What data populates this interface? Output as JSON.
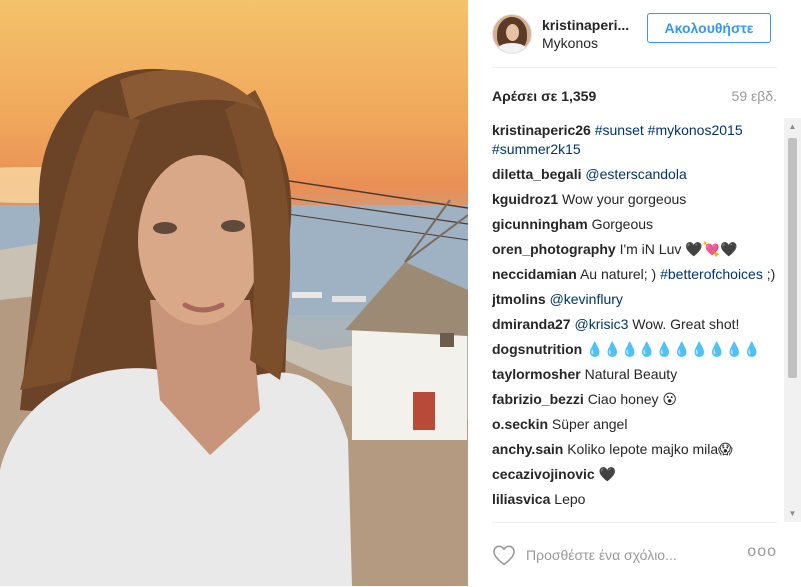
{
  "post": {
    "username": "kristinaperi...",
    "location": "Mykonos",
    "follow_label": "Ακολουθήστε",
    "likes": "Αρέσει σε 1,359",
    "time": "59 εβδ."
  },
  "comments": [
    {
      "user": "kristinaperic26",
      "link": "#sunset #mykonos2015 #summer2k15",
      "text": ""
    },
    {
      "user": "diletta_begali",
      "link": "@esterscandola",
      "text": ""
    },
    {
      "user": "kguidroz1",
      "link": "",
      "text": "Wow your gorgeous"
    },
    {
      "user": "gicunningham",
      "link": "",
      "text": "Gorgeous"
    },
    {
      "user": "oren_photography",
      "link": "",
      "text": "I'm iN Luv 🖤💘🖤"
    },
    {
      "user": "neccidamian",
      "link": "",
      "text": "Au naturel; )",
      "link2": "#betterofchoices",
      "text2": ";)"
    },
    {
      "user": "jtmolins",
      "link": "@kevinflury",
      "text": ""
    },
    {
      "user": "dmiranda27",
      "link": "@krisic3",
      "text": "Wow. Great shot!"
    },
    {
      "user": "dogsnutrition",
      "link": "",
      "text": "💧💧💧💧💧💧💧💧💧💧"
    },
    {
      "user": "taylormosher",
      "link": "",
      "text": "Natural Beauty"
    },
    {
      "user": "fabrizio_bezzi",
      "link": "",
      "text": "Ciao honey 😮"
    },
    {
      "user": "o.seckin",
      "link": "",
      "text": "Süper angel"
    },
    {
      "user": "anchy.sain",
      "link": "",
      "text": "Koliko lepote majko mila😱"
    },
    {
      "user": "cecazivojinovic",
      "link": "",
      "text": "🖤"
    },
    {
      "user": "liliasvica",
      "link": "",
      "text": "Lepo"
    }
  ],
  "footer": {
    "placeholder": "Προσθέστε ένα σχόλιο...",
    "more": "ooo"
  },
  "icons": {
    "like": "heart-outline-icon",
    "options": "more-options-icon"
  },
  "colors": {
    "link": "#003569",
    "follow": "#3897f0"
  }
}
